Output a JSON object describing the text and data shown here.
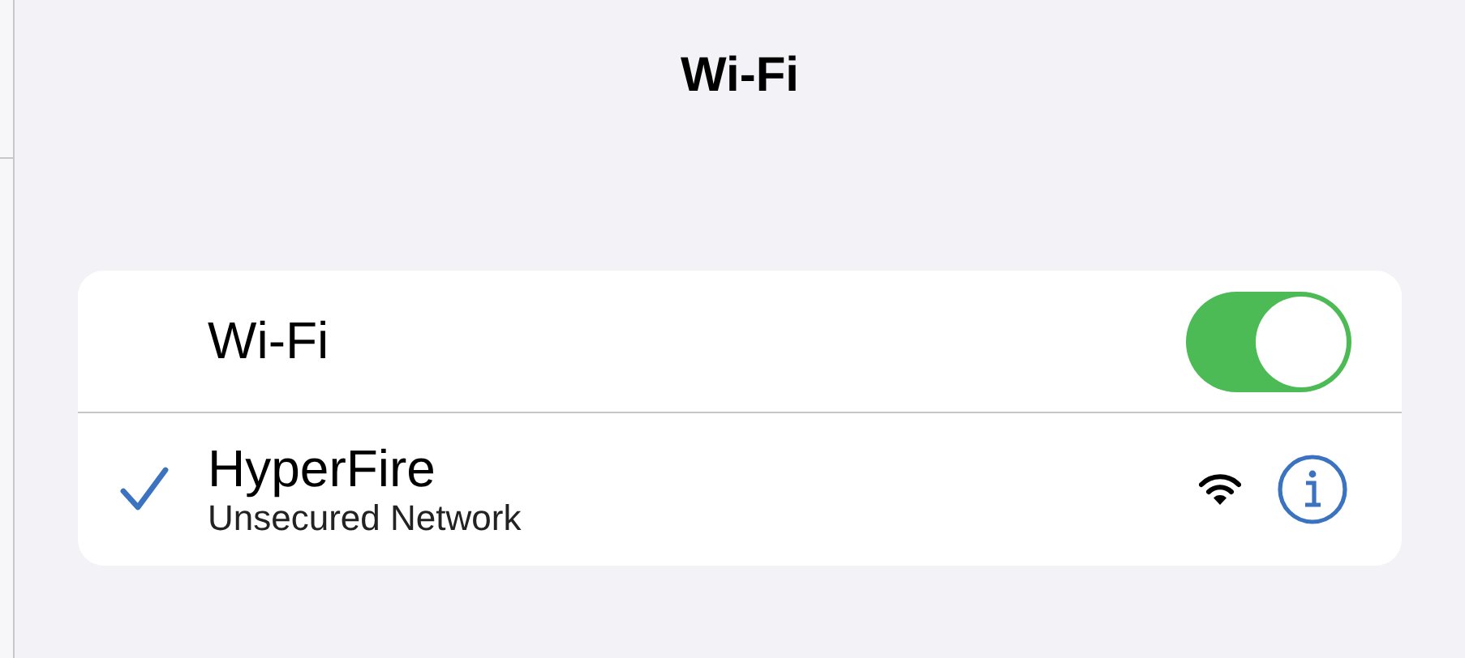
{
  "title": "Wi-Fi",
  "wifi_toggle": {
    "label": "Wi-Fi",
    "on": true
  },
  "networks": [
    {
      "name": "HyperFire",
      "subtitle": "Unsecured Network",
      "connected": true
    }
  ]
}
